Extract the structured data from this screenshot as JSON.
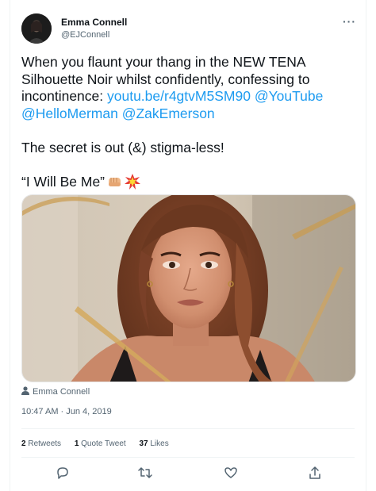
{
  "author": {
    "name": "Emma Connell",
    "handle": "@EJConnell"
  },
  "more_label": "···",
  "tweet": {
    "line1": "When you flaunt your thang in the NEW TENA",
    "line2": "Silhouette Noir whilst confidently, confessing to",
    "line3_prefix": "incontinence: ",
    "link_url": "youtu.be/r4gtvM5SM90",
    "mention_youtube": "@YouTube",
    "mention_merman": "@HelloMerman",
    "mention_zak": "@ZakEmerson",
    "line_secret": "The secret is out (&) stigma-less!",
    "line_quote": "“I Will Be Me”"
  },
  "media_credit": "Emma Connell",
  "timestamp": "10:47 AM · Jun 4, 2019",
  "stats": {
    "retweets_count": "2",
    "retweets_label": "Retweets",
    "quotes_count": "1",
    "quotes_label": "Quote Tweet",
    "likes_count": "37",
    "likes_label": "Likes"
  },
  "icons": {
    "more": "more-icon",
    "reply": "reply-icon",
    "retweet": "retweet-icon",
    "like": "heart-icon",
    "share": "share-icon",
    "person": "person-icon"
  },
  "colors": {
    "link": "#1d9bf0",
    "secondary_text": "#536471",
    "primary_text": "#0f1419"
  }
}
